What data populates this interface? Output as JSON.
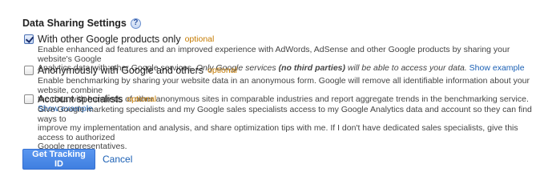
{
  "section": {
    "title": "Data Sharing Settings",
    "help_glyph": "?"
  },
  "options": [
    {
      "label": "With other Google products only",
      "optional_tag": "optional",
      "checked": true,
      "desc_line1": "Enable enhanced ad features and an improved experience with AdWords, AdSense and other Google products by sharing your website's Google",
      "desc_line2_prefix": "Analytics data with other Google services. ",
      "desc_line2_italic_a": "Only Google services ",
      "desc_line2_bold": "(no third parties)",
      "desc_line2_italic_b": " will be able to access your data.",
      "link": "Show example"
    },
    {
      "label": "Anonymously with Google and others",
      "optional_tag": "optional",
      "checked": false,
      "desc_line1": "Enable benchmarking by sharing your website data in an anonymous form. Google will remove all identifiable information about your website, combine",
      "desc_line2": "the data with hundreds of other anonymous sites in comparable industries and report aggregate trends in the benchmarking service.",
      "link": "Show example"
    },
    {
      "label": "Account specialists",
      "optional_tag": "optional",
      "checked": false,
      "desc_line1": "Give Google marketing specialists and my Google sales specialists access to my Google Analytics data and account so they can find ways to",
      "desc_line2": "improve my implementation and analysis, and share optimization tips with me. If I don't have dedicated sales specialists, give this access to authorized",
      "desc_line3": "Google representatives."
    }
  ],
  "actions": {
    "primary_label": "Get Tracking ID",
    "cancel_label": "Cancel"
  },
  "colors": {
    "primary_button": "#4a8af4",
    "link": "#1a5fb4",
    "optional_tag": "#c47a00"
  }
}
